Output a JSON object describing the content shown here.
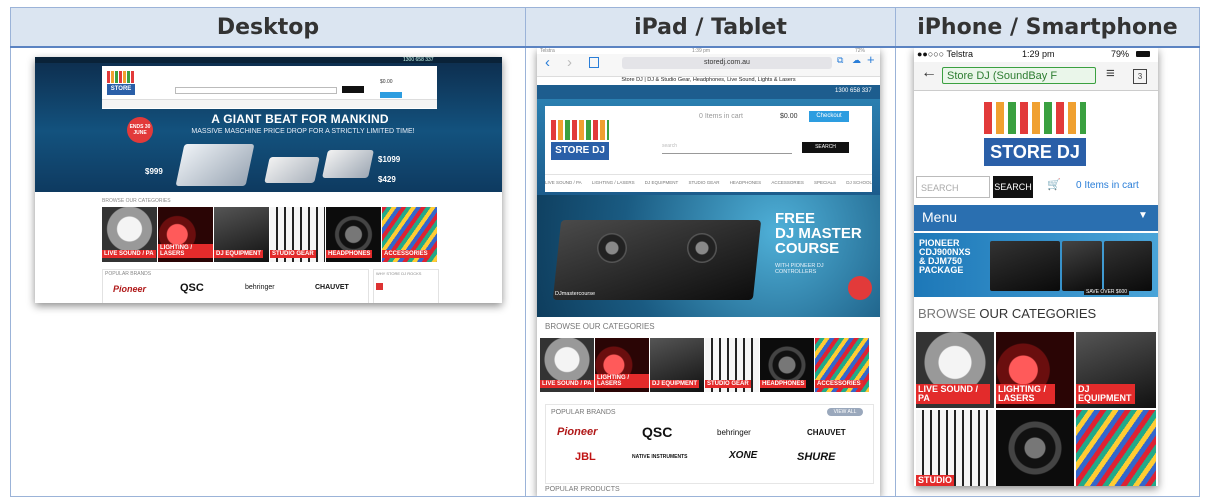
{
  "columns": [
    "Desktop",
    "iPad / Tablet",
    "iPhone / Smartphone"
  ],
  "desktop": {
    "contact": "1300 658 337",
    "basket_total": "$0.00",
    "hero_title": "A GIANT BEAT FOR MANKIND",
    "hero_subtitle": "MASSIVE MASCHINE PRICE DROP FOR A STRICTLY LIMITED TIME!",
    "promo_badge": "ENDS 30 JUNE",
    "price_a": "$999",
    "price_b": "$1099",
    "price_c": "$429",
    "browse_heading": "BROWSE OUR CATEGORIES",
    "categories": [
      "LIVE SOUND / PA",
      "LIGHTING / LASERS",
      "DJ EQUIPMENT",
      "STUDIO GEAR",
      "HEADPHONES",
      "ACCESSORIES"
    ],
    "brands_heading": "POPULAR BRANDS",
    "side_heading": "WHY STORE DJ ROCKS",
    "brands": [
      "Pioneer",
      "QSC",
      "behringer",
      "CHAUVET"
    ]
  },
  "ipad": {
    "status_carrier": "Telstra",
    "status_time": "1:39 pm",
    "status_battery": "72%",
    "url": "storedj.com.au",
    "page_title": "Store DJ | DJ & Studio Gear, Headphones, Live Sound, Lights & Lasers",
    "phone": "1300 658 337",
    "cart_text": "0 Items in cart",
    "cart_total": "$0.00",
    "checkout": "Checkout",
    "search_placeholder": "search",
    "search_button": "SEARCH",
    "menu_items": [
      "LIVE SOUND / PA",
      "LIGHTING / LASERS",
      "DJ EQUIPMENT",
      "STUDIO GEAR",
      "HEADPHONES",
      "ACCESSORIES",
      "SPECIALS",
      "DJ SCHOOL"
    ],
    "hero_line1": "FREE",
    "hero_line2": "DJ MASTER",
    "hero_line3": "COURSE",
    "hero_sub": "WITH PIONEER DJ CONTROLLERS",
    "hero_logo": "DJmastercourse",
    "browse_heading": "BROWSE OUR CATEGORIES",
    "categories": [
      "LIVE SOUND / PA",
      "LIGHTING / LASERS",
      "DJ EQUIPMENT",
      "STUDIO GEAR",
      "HEADPHONES",
      "ACCESSORIES"
    ],
    "brands_heading": "POPULAR BRANDS",
    "brands_button": "VIEW ALL",
    "brands_row1": [
      "Pioneer",
      "QSC",
      "behringer",
      "CHAUVET"
    ],
    "brands_row2": [
      "JBL",
      "NATIVE INSTRUMENTS",
      "XONE",
      "SHURE"
    ],
    "products_heading": "POPULAR PRODUCTS"
  },
  "iphone": {
    "carrier": "●●○○○ Telstra",
    "time": "1:29 pm",
    "battery": "79%",
    "url": "Store DJ (SoundBay F",
    "tab_count": "3",
    "search_placeholder": "SEARCH",
    "search_button": "SEARCH",
    "cart": "0 Items in cart",
    "menu": "Menu",
    "promo_title": "PIONEER CDJ900NXS & DJM750 PACKAGE",
    "promo_note": "SAVE OVER $600",
    "browse_prefix": "BROWSE ",
    "browse_emphasis": "OUR CATEGORIES",
    "categories": [
      "LIVE SOUND / PA",
      "LIGHTING / LASERS",
      "DJ EQUIPMENT",
      "STUDIO"
    ]
  },
  "colors": {
    "header_bg": "#dbe5f1",
    "border": "#9bb3d8",
    "accent_red": "#e32b2b",
    "menu_blue": "#2a6fb0"
  }
}
